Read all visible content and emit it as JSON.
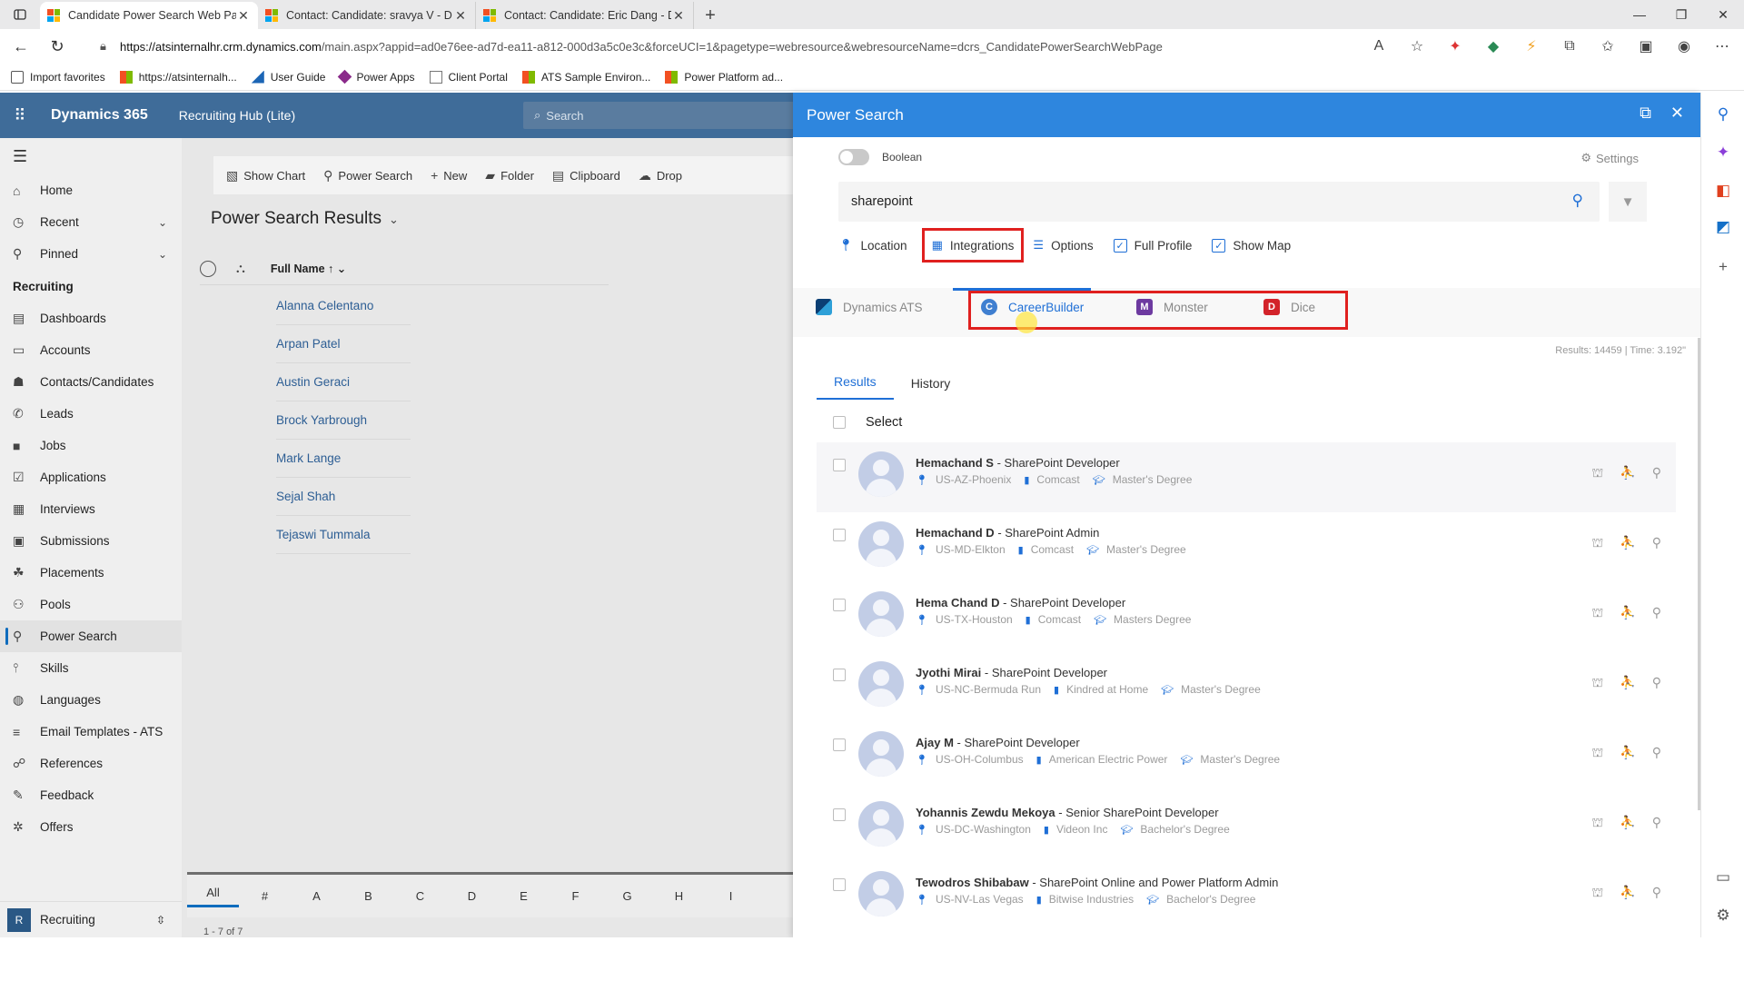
{
  "browser": {
    "tabs": [
      {
        "title": "Candidate Power Search Web Pa",
        "active": true
      },
      {
        "title": "Contact: Candidate: sravya V - D",
        "active": false
      },
      {
        "title": "Contact: Candidate: Eric Dang - D",
        "active": false
      }
    ],
    "url_host": "https://atsinternalhr.crm.dynamics.com",
    "url_path": "/main.aspx?appid=ad0e76ee-ad7d-ea11-a812-000d3a5c0e3c&forceUCI=1&pagetype=webresource&webresourceName=dcrs_CandidatePowerSearchWebPage",
    "favorites": [
      {
        "label": "Import favorites",
        "icon": "import-icon"
      },
      {
        "label": "https://atsinternalh...",
        "icon": "microsoft-logo"
      },
      {
        "label": "User Guide",
        "icon": "dynamics-logo"
      },
      {
        "label": "Power Apps",
        "icon": "powerapps-logo"
      },
      {
        "label": "Client Portal",
        "icon": "page-icon"
      },
      {
        "label": "ATS Sample Environ...",
        "icon": "microsoft-logo"
      },
      {
        "label": "Power Platform ad...",
        "icon": "microsoft-logo"
      }
    ]
  },
  "app": {
    "brand": "Dynamics 365",
    "app_name": "Recruiting Hub (Lite)",
    "search_placeholder": "Search"
  },
  "nav": {
    "top": [
      {
        "label": "Home",
        "icon": "home-icon"
      },
      {
        "label": "Recent",
        "icon": "clock-icon",
        "chevron": true
      },
      {
        "label": "Pinned",
        "icon": "pin-icon",
        "chevron": true
      }
    ],
    "section": "Recruiting",
    "items": [
      {
        "label": "Dashboards",
        "icon": "dashboard-icon"
      },
      {
        "label": "Accounts",
        "icon": "document-icon"
      },
      {
        "label": "Contacts/Candidates",
        "icon": "people-icon"
      },
      {
        "label": "Leads",
        "icon": "phone-icon"
      },
      {
        "label": "Jobs",
        "icon": "briefcase-icon"
      },
      {
        "label": "Applications",
        "icon": "checklist-icon"
      },
      {
        "label": "Interviews",
        "icon": "calendar-icon"
      },
      {
        "label": "Submissions",
        "icon": "submit-icon"
      },
      {
        "label": "Placements",
        "icon": "placement-icon"
      },
      {
        "label": "Pools",
        "icon": "pool-icon"
      },
      {
        "label": "Power Search",
        "icon": "search-icon",
        "active": true
      },
      {
        "label": "Skills",
        "icon": "skills-icon"
      },
      {
        "label": "Languages",
        "icon": "globe-icon"
      },
      {
        "label": "Email Templates - ATS",
        "icon": "template-icon"
      },
      {
        "label": "References",
        "icon": "reference-icon"
      },
      {
        "label": "Feedback",
        "icon": "feedback-icon"
      },
      {
        "label": "Offers",
        "icon": "offer-icon"
      }
    ],
    "area": {
      "badge": "R",
      "label": "Recruiting"
    }
  },
  "main": {
    "commands": [
      "Show Chart",
      "Power Search",
      "New",
      "Folder",
      "Clipboard",
      "Drop"
    ],
    "view_title": "Power Search Results",
    "column": "Full Name",
    "rows": [
      "Alanna Celentano",
      "Arpan Patel",
      "Austin Geraci",
      "Brock Yarbrough",
      "Mark Lange",
      "Sejal Shah",
      "Tejaswi Tummala"
    ],
    "alpha": [
      "All",
      "#",
      "A",
      "B",
      "C",
      "D",
      "E",
      "F",
      "G",
      "H",
      "I"
    ],
    "pager": "1 - 7 of 7"
  },
  "panel": {
    "title": "Power Search",
    "boolean_label": "Boolean",
    "settings_label": "Settings",
    "search_value": "sharepoint",
    "options": {
      "location": "Location",
      "integrations": "Integrations",
      "options": "Options",
      "full_profile": "Full Profile",
      "show_map": "Show Map"
    },
    "sources": [
      {
        "label": "Dynamics ATS"
      },
      {
        "label": "CareerBuilder"
      },
      {
        "label": "Monster"
      },
      {
        "label": "Dice"
      }
    ],
    "stats": "Results: 14459 | Time: 3.192\"",
    "result_tabs": [
      "Results",
      "History"
    ],
    "select_label": "Select",
    "results": [
      {
        "name": "Hemachand S",
        "title": "SharePoint Developer",
        "location": "US-AZ-Phoenix",
        "company": "Comcast",
        "degree": "Master's Degree"
      },
      {
        "name": "Hemachand D",
        "title": "SharePoint Admin",
        "location": "US-MD-Elkton",
        "company": "Comcast",
        "degree": "Master's Degree"
      },
      {
        "name": "Hema Chand D",
        "title": "SharePoint Developer",
        "location": "US-TX-Houston",
        "company": "Comcast",
        "degree": "Masters Degree"
      },
      {
        "name": "Jyothi Mirai",
        "title": "SharePoint Developer",
        "location": "US-NC-Bermuda Run",
        "company": "Kindred at Home",
        "degree": "Master's Degree"
      },
      {
        "name": "Ajay M",
        "title": "SharePoint Developer",
        "location": "US-OH-Columbus",
        "company": "American Electric Power",
        "degree": "Master's Degree"
      },
      {
        "name": "Yohannis Zewdu Mekoya",
        "title": "Senior SharePoint Developer",
        "location": "US-DC-Washington",
        "company": "Videon Inc",
        "degree": "Bachelor's Degree"
      },
      {
        "name": "Tewodros Shibabaw",
        "title": "SharePoint Online and Power Platform Admin",
        "location": "US-NV-Las Vegas",
        "company": "Bitwise Industries",
        "degree": "Bachelor's Degree"
      }
    ]
  },
  "colors": {
    "panel_header": "#2e86de",
    "app_header": "#3f6c99",
    "highlight_box": "#e0201f",
    "link": "#2d5e94"
  }
}
